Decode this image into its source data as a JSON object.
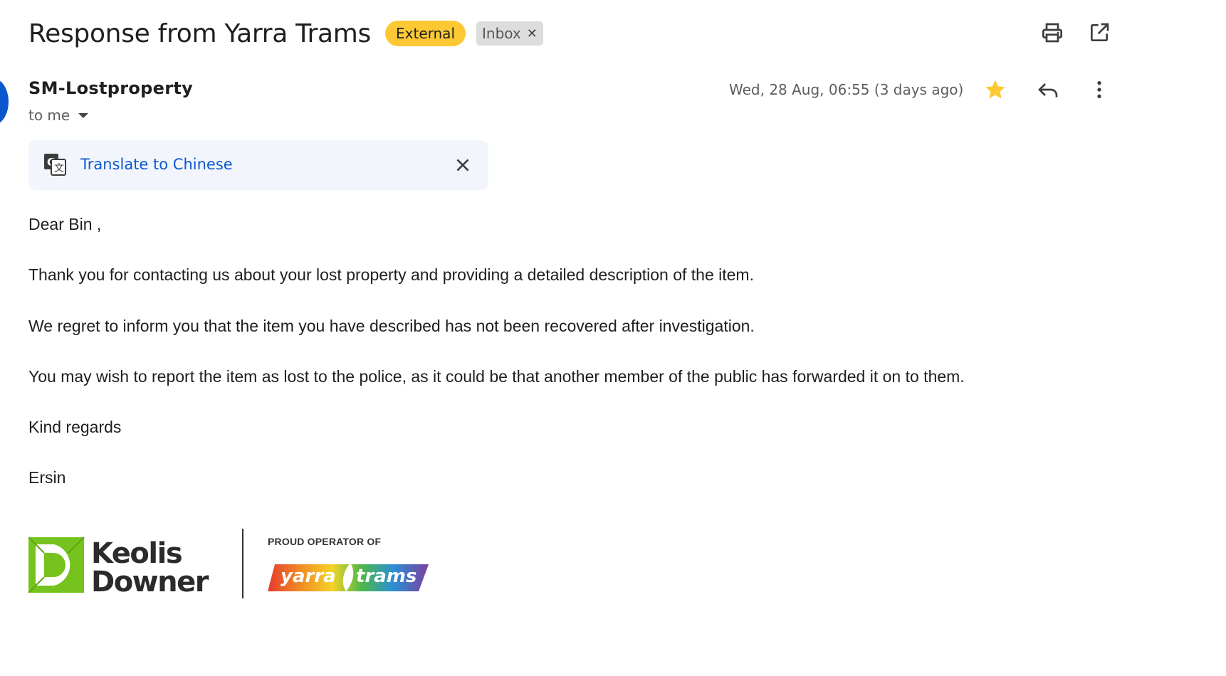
{
  "subject": {
    "title": "Response from Yarra Trams",
    "labels": {
      "external": "External",
      "inbox": "Inbox",
      "remove_icon": "close-x-icon"
    }
  },
  "toolbar": {
    "print_icon": "print-icon",
    "open_new_window_icon": "open-in-new-icon"
  },
  "message": {
    "sender": "SM-Lostproperty",
    "recipient": "to me",
    "date": "Wed, 28 Aug, 06:55 (3 days ago)",
    "starred": true,
    "star_color": "#fcc934",
    "icons": [
      "star-icon",
      "reply-icon",
      "more-vertical-icon"
    ]
  },
  "translate": {
    "link": "Translate to Chinese",
    "icon": "google-translate-icon",
    "link_color": "#0b57d0"
  },
  "body": {
    "greeting": "Dear Bin ,",
    "para1": "Thank you for contacting us about your lost property and providing a detailed description of the item.",
    "para2": "We regret to inform you that the item you have described has not been recovered after investigation.",
    "para3": "You may wish to report the item as lost to the police, as it could be that another member of the public has forwarded it on to them.",
    "closing": "Kind regards",
    "signoff": "Ersin"
  },
  "signature": {
    "logo_line1": "Keolis",
    "logo_line2": "Downer",
    "proud_text": "PROUD OPERATOR OF",
    "yarra_trams_part1": "yarra",
    "yarra_trams_part2": "trams",
    "brand_green": "#76c31e"
  }
}
